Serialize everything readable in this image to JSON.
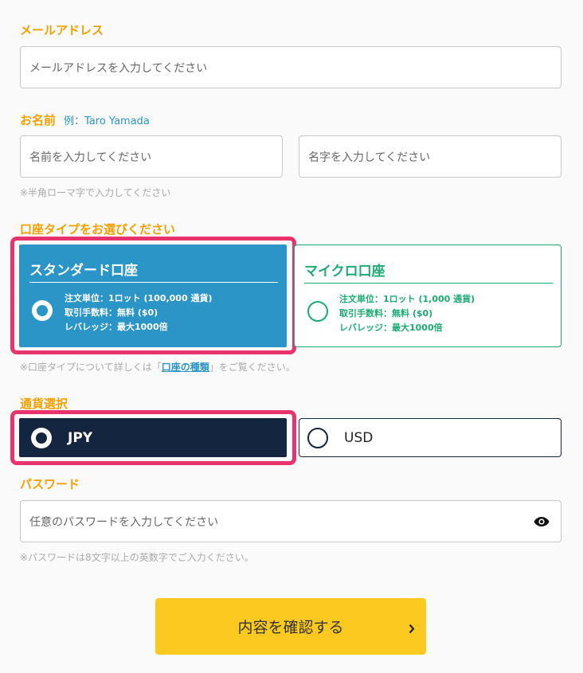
{
  "email": {
    "label": "メールアドレス",
    "placeholder": "メールアドレスを入力してください"
  },
  "name": {
    "label": "お名前",
    "example": "例：Taro Yamada",
    "first_placeholder": "名前を入力してください",
    "last_placeholder": "名字を入力してください",
    "note": "※半角ローマ字で入力してください"
  },
  "account_type": {
    "label": "口座タイプをお選びください",
    "standard": {
      "title": "スタンダード口座",
      "lines": [
        "注文単位：1ロット (100,000 通貨)",
        "取引手数料：無料 ($0)",
        "レバレッジ：最大1000倍"
      ],
      "selected": true
    },
    "micro": {
      "title": "マイクロ口座",
      "lines": [
        "注文単位：1ロット (1,000 通貨)",
        "取引手数料：無料 ($0)",
        "レバレッジ：最大1000倍"
      ],
      "selected": false
    },
    "note_prefix": "※口座タイプについて詳しくは「",
    "note_link": "口座の種類",
    "note_suffix": "」をご覧ください。"
  },
  "currency": {
    "label": "通貨選択",
    "options": [
      {
        "label": "JPY",
        "selected": true
      },
      {
        "label": "USD",
        "selected": false
      }
    ]
  },
  "password": {
    "label": "パスワード",
    "placeholder": "任意のパスワードを入力してください",
    "toggle_icon": "eye-icon",
    "note": "※パスワードは8文字以上の英数字でご入力ください。"
  },
  "submit": {
    "label": "内容を確認する",
    "icon": "chevron-right-icon"
  },
  "colors": {
    "label": "#f5a000",
    "standard_bg": "#2b95c8",
    "micro_accent": "#1cab72",
    "jpy_bg": "#14253f",
    "highlight": "#e8336d",
    "button": "#fcc920"
  }
}
